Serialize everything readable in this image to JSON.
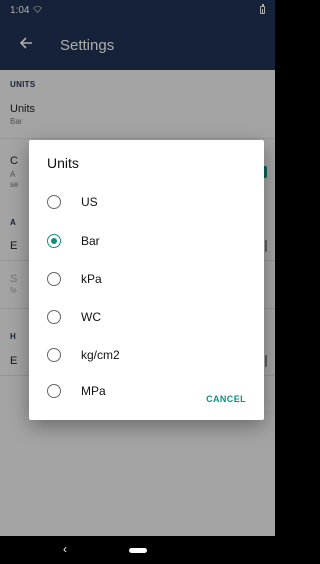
{
  "status_bar": {
    "time": "1:04",
    "wifi_icon": "wifi-icon",
    "battery_icon": "battery-icon"
  },
  "app_bar": {
    "title": "Settings",
    "back_icon": "arrow-left-icon"
  },
  "background": {
    "units_section": "UNITS",
    "units_pref": {
      "title": "Units",
      "summary": "Bar"
    },
    "partial_rows": [
      {
        "title": "C",
        "summary_lines": [
          "A",
          "se"
        ]
      },
      {
        "title": "A"
      },
      {
        "title": "E"
      },
      {
        "title": "S",
        "summary": "fe"
      },
      {
        "title": "H"
      },
      {
        "title": "E"
      }
    ]
  },
  "dialog": {
    "title": "Units",
    "options": [
      {
        "label": "US",
        "selected": false
      },
      {
        "label": "Bar",
        "selected": true
      },
      {
        "label": "kPa",
        "selected": false
      },
      {
        "label": "WC",
        "selected": false
      },
      {
        "label": "kg/cm2",
        "selected": false
      },
      {
        "label": "MPa",
        "selected": false
      }
    ],
    "cancel_label": "CANCEL"
  },
  "colors": {
    "primary": "#1f3354",
    "accent": "#128e85",
    "background": "#f2f2f2"
  },
  "nav_bar": {
    "back_glyph": "‹"
  }
}
